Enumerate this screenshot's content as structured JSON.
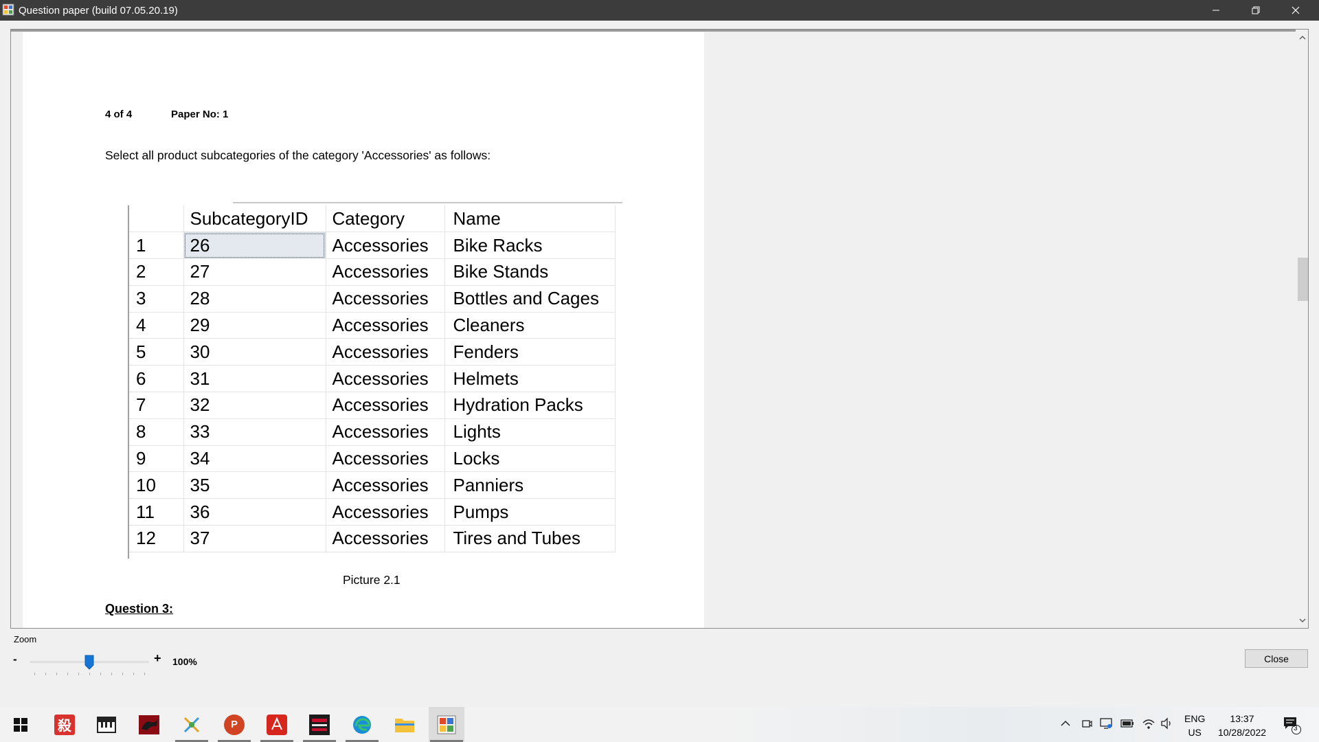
{
  "window": {
    "title": "Question paper (build 07.05.20.19)"
  },
  "page": {
    "page_number": "4 of 4",
    "paper_no": "Paper No: 1",
    "question_text": "Select all product subcategories of the category 'Accessories' as follows:",
    "caption": "Picture 2.1",
    "next_question": "Question 3:"
  },
  "result_grid": {
    "columns": [
      "",
      "SubcategoryID",
      "Category",
      "Name"
    ],
    "rows": [
      [
        "1",
        "26",
        "Accessories",
        "Bike Racks"
      ],
      [
        "2",
        "27",
        "Accessories",
        "Bike Stands"
      ],
      [
        "3",
        "28",
        "Accessories",
        "Bottles and Cages"
      ],
      [
        "4",
        "29",
        "Accessories",
        "Cleaners"
      ],
      [
        "5",
        "30",
        "Accessories",
        "Fenders"
      ],
      [
        "6",
        "31",
        "Accessories",
        "Helmets"
      ],
      [
        "7",
        "32",
        "Accessories",
        "Hydration Packs"
      ],
      [
        "8",
        "33",
        "Accessories",
        "Lights"
      ],
      [
        "9",
        "34",
        "Accessories",
        "Locks"
      ],
      [
        "10",
        "35",
        "Accessories",
        "Panniers"
      ],
      [
        "11",
        "36",
        "Accessories",
        "Pumps"
      ],
      [
        "12",
        "37",
        "Accessories",
        "Tires and Tubes"
      ]
    ]
  },
  "zoom": {
    "label": "Zoom",
    "minus": "-",
    "plus": "+",
    "value_label": "100%",
    "slider_fraction": 0.5
  },
  "buttons": {
    "close": "Close"
  },
  "taskbar": {
    "apps": [
      {
        "name": "start-icon",
        "color": "#000000"
      },
      {
        "name": "kanji-app-icon",
        "color": "#d9322e",
        "glyph": "殺"
      },
      {
        "name": "piano-app-icon",
        "color": "#222222"
      },
      {
        "name": "red-dragon-app-icon",
        "color": "#b3141c"
      },
      {
        "name": "tools-app-icon",
        "color": "#3a9ad9"
      },
      {
        "name": "powerpoint-icon",
        "color": "#d04423",
        "glyph": "P"
      },
      {
        "name": "acrobat-icon",
        "color": "#d7261e"
      },
      {
        "name": "sql-tool-icon",
        "color": "#1c1c1c"
      },
      {
        "name": "edge-icon",
        "color": "#1a8fd6"
      },
      {
        "name": "file-explorer-icon",
        "color": "#f3c13a"
      },
      {
        "name": "question-paper-app-icon",
        "color": "#e2a420"
      }
    ],
    "language": "ENG",
    "region": "US",
    "time": "13:37",
    "date": "10/28/2022",
    "notification_count": "3"
  }
}
